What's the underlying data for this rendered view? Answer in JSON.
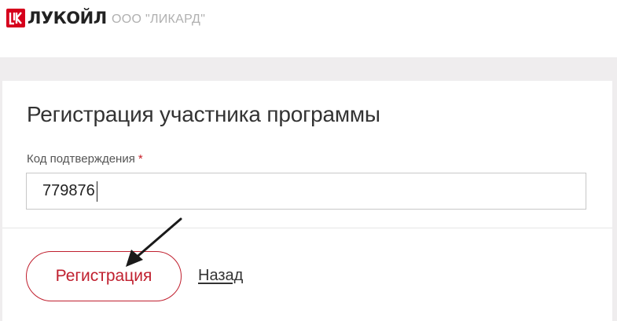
{
  "header": {
    "logo_text": "ЛУКОЙЛ",
    "company": "ООО \"ЛИКАРД\""
  },
  "form": {
    "title": "Регистрация участника программы",
    "field_label": "Код подтверждения",
    "required_mark": "*",
    "code_value": "779876",
    "register_label": "Регистрация",
    "back_label": "Назад"
  },
  "colors": {
    "brand_red": "#c0202f",
    "logo_red": "#d6001c",
    "page_bg": "#efedee"
  },
  "icons": {
    "logo": "lukoil-logo-icon",
    "annotation": "arrow-pointer-icon"
  }
}
